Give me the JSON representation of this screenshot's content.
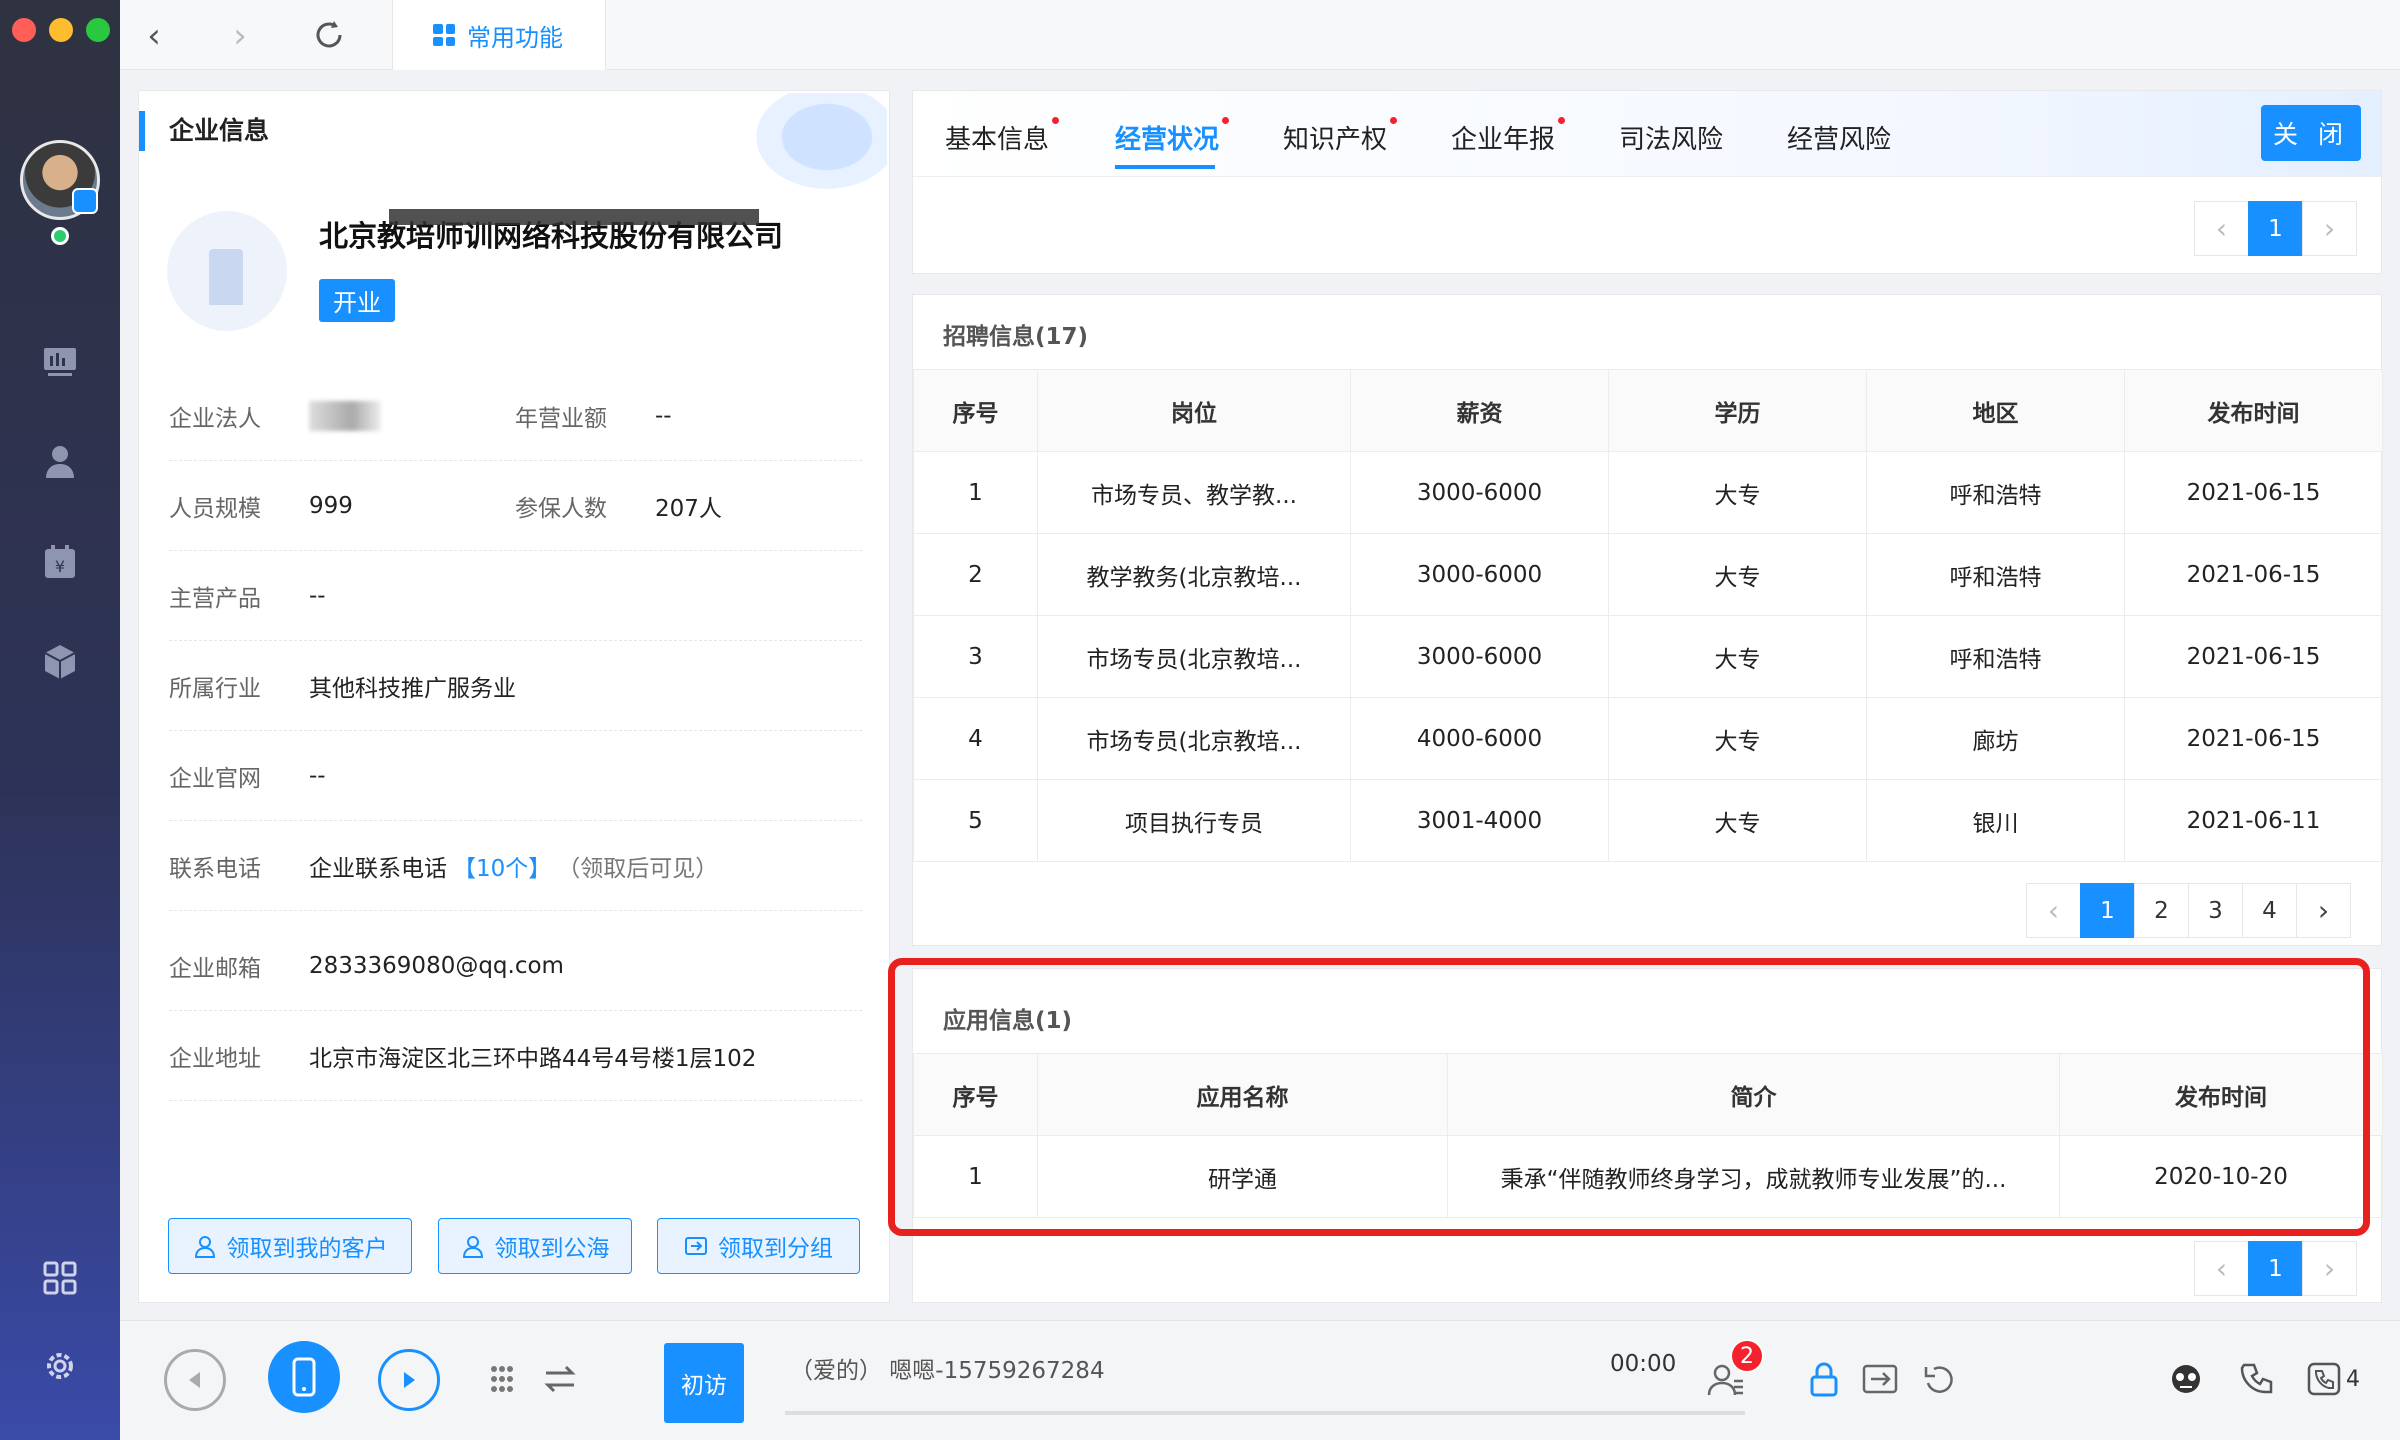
{
  "toolbar": {
    "fav_tab_label": "常用功能"
  },
  "company": {
    "panel_title": "企业信息",
    "name": "北京教培师训网络科技股份有限公司",
    "status": "开业",
    "fields": {
      "legal_rep_label": "企业法人",
      "revenue_label": "年营业额",
      "revenue_value": "--",
      "staff_label": "人员规模",
      "staff_value": "999",
      "insured_label": "参保人数",
      "insured_value": "207人",
      "product_label": "主营产品",
      "product_value": "--",
      "industry_label": "所属行业",
      "industry_value": "其他科技推广服务业",
      "website_label": "企业官网",
      "website_value": "--",
      "phone_label": "联系电话",
      "phone_value": "企业联系电话",
      "phone_count": "【10个】",
      "phone_hint": "（领取后可见）",
      "email_label": "企业邮箱",
      "email_value": "2833369080@qq.com",
      "address_label": "企业地址",
      "address_value": "北京市海淀区北三环中路44号4号楼1层102"
    },
    "actions": [
      "领取到我的客户",
      "领取到公海",
      "领取到分组"
    ]
  },
  "tabs": [
    "基本信息",
    "经营状况",
    "知识产权",
    "企业年报",
    "司法风险",
    "经营风险"
  ],
  "close_label": "关 闭",
  "top_pager": {
    "current": "1"
  },
  "recruit": {
    "title": "招聘信息(17)",
    "headers": [
      "序号",
      "岗位",
      "薪资",
      "学历",
      "地区",
      "发布时间"
    ],
    "rows": [
      [
        "1",
        "市场专员、教学教...",
        "3000-6000",
        "大专",
        "呼和浩特",
        "2021-06-15"
      ],
      [
        "2",
        "教学教务(北京教培...",
        "3000-6000",
        "大专",
        "呼和浩特",
        "2021-06-15"
      ],
      [
        "3",
        "市场专员(北京教培...",
        "3000-6000",
        "大专",
        "呼和浩特",
        "2021-06-15"
      ],
      [
        "4",
        "市场专员(北京教培...",
        "4000-6000",
        "大专",
        "廊坊",
        "2021-06-15"
      ],
      [
        "5",
        "项目执行专员",
        "3001-4000",
        "大专",
        "银川",
        "2021-06-11"
      ]
    ],
    "pages": [
      "1",
      "2",
      "3",
      "4"
    ]
  },
  "apps": {
    "title": "应用信息(1)",
    "headers": [
      "序号",
      "应用名称",
      "简介",
      "发布时间"
    ],
    "rows": [
      [
        "1",
        "研学通",
        "秉承“伴随教师终身学习，成就教师专业发展”的...",
        "2020-10-20"
      ]
    ],
    "pages": [
      "1"
    ]
  },
  "callbar": {
    "visit_label": "初访",
    "caller": "（爱的）   嗯嗯-15759267284",
    "timer": "00:00",
    "badge_count": "2",
    "line_count": "4"
  },
  "colors": {
    "accent": "#1890ff",
    "highlight": "#e8211f",
    "rail_top": "#2f3240",
    "rail_bottom": "#3a4aa8"
  }
}
